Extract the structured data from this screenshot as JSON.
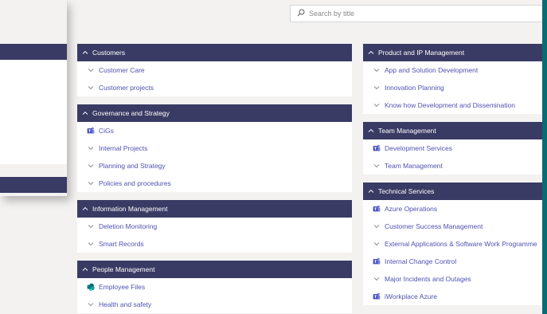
{
  "search": {
    "placeholder": "Search by title"
  },
  "colors": {
    "header": "#3a3b64",
    "link": "#4f52b2",
    "frame": "#0b6b73"
  },
  "columns": [
    [
      {
        "title": "Customers",
        "items": [
          {
            "label": "Customer Care",
            "icon": "chevron-down-icon"
          },
          {
            "label": "Customer projects",
            "icon": "chevron-down-icon"
          }
        ]
      },
      {
        "title": "Governance and Strategy",
        "items": [
          {
            "label": "CiGs",
            "icon": "teams-icon"
          },
          {
            "label": "Internal Projects",
            "icon": "chevron-down-icon"
          },
          {
            "label": "Planning and Strategy",
            "icon": "chevron-down-icon"
          },
          {
            "label": "Policies and procedures",
            "icon": "chevron-down-icon"
          }
        ]
      },
      {
        "title": "Information Management",
        "items": [
          {
            "label": "Deletion Monitoring",
            "icon": "chevron-down-icon"
          },
          {
            "label": "Smart Records",
            "icon": "chevron-down-icon"
          }
        ]
      },
      {
        "title": "People Management",
        "items": [
          {
            "label": "Employee Files",
            "icon": "sharepoint-icon"
          },
          {
            "label": "Health and safety",
            "icon": "chevron-down-icon"
          }
        ]
      }
    ],
    [
      {
        "title": "Product and IP Management",
        "items": [
          {
            "label": "App and Solution Development",
            "icon": "chevron-down-icon"
          },
          {
            "label": "Innovation Planning",
            "icon": "chevron-down-icon"
          },
          {
            "label": "Know how Development and Dissemination",
            "icon": "chevron-down-icon"
          }
        ]
      },
      {
        "title": "Team Management",
        "items": [
          {
            "label": "Development Services",
            "icon": "teams-icon"
          },
          {
            "label": "Team Management",
            "icon": "chevron-down-icon"
          }
        ]
      },
      {
        "title": "Technical Services",
        "items": [
          {
            "label": "Azure Operations",
            "icon": "teams-icon"
          },
          {
            "label": "Customer Success Management",
            "icon": "chevron-down-icon"
          },
          {
            "label": "External Applications & Software Work Programme",
            "icon": "chevron-down-icon"
          },
          {
            "label": "Internal Change Control",
            "icon": "teams-icon"
          },
          {
            "label": "Major Incidents and Outages",
            "icon": "chevron-down-icon"
          },
          {
            "label": "iWorkplace Azure",
            "icon": "teams-icon"
          }
        ]
      }
    ]
  ]
}
